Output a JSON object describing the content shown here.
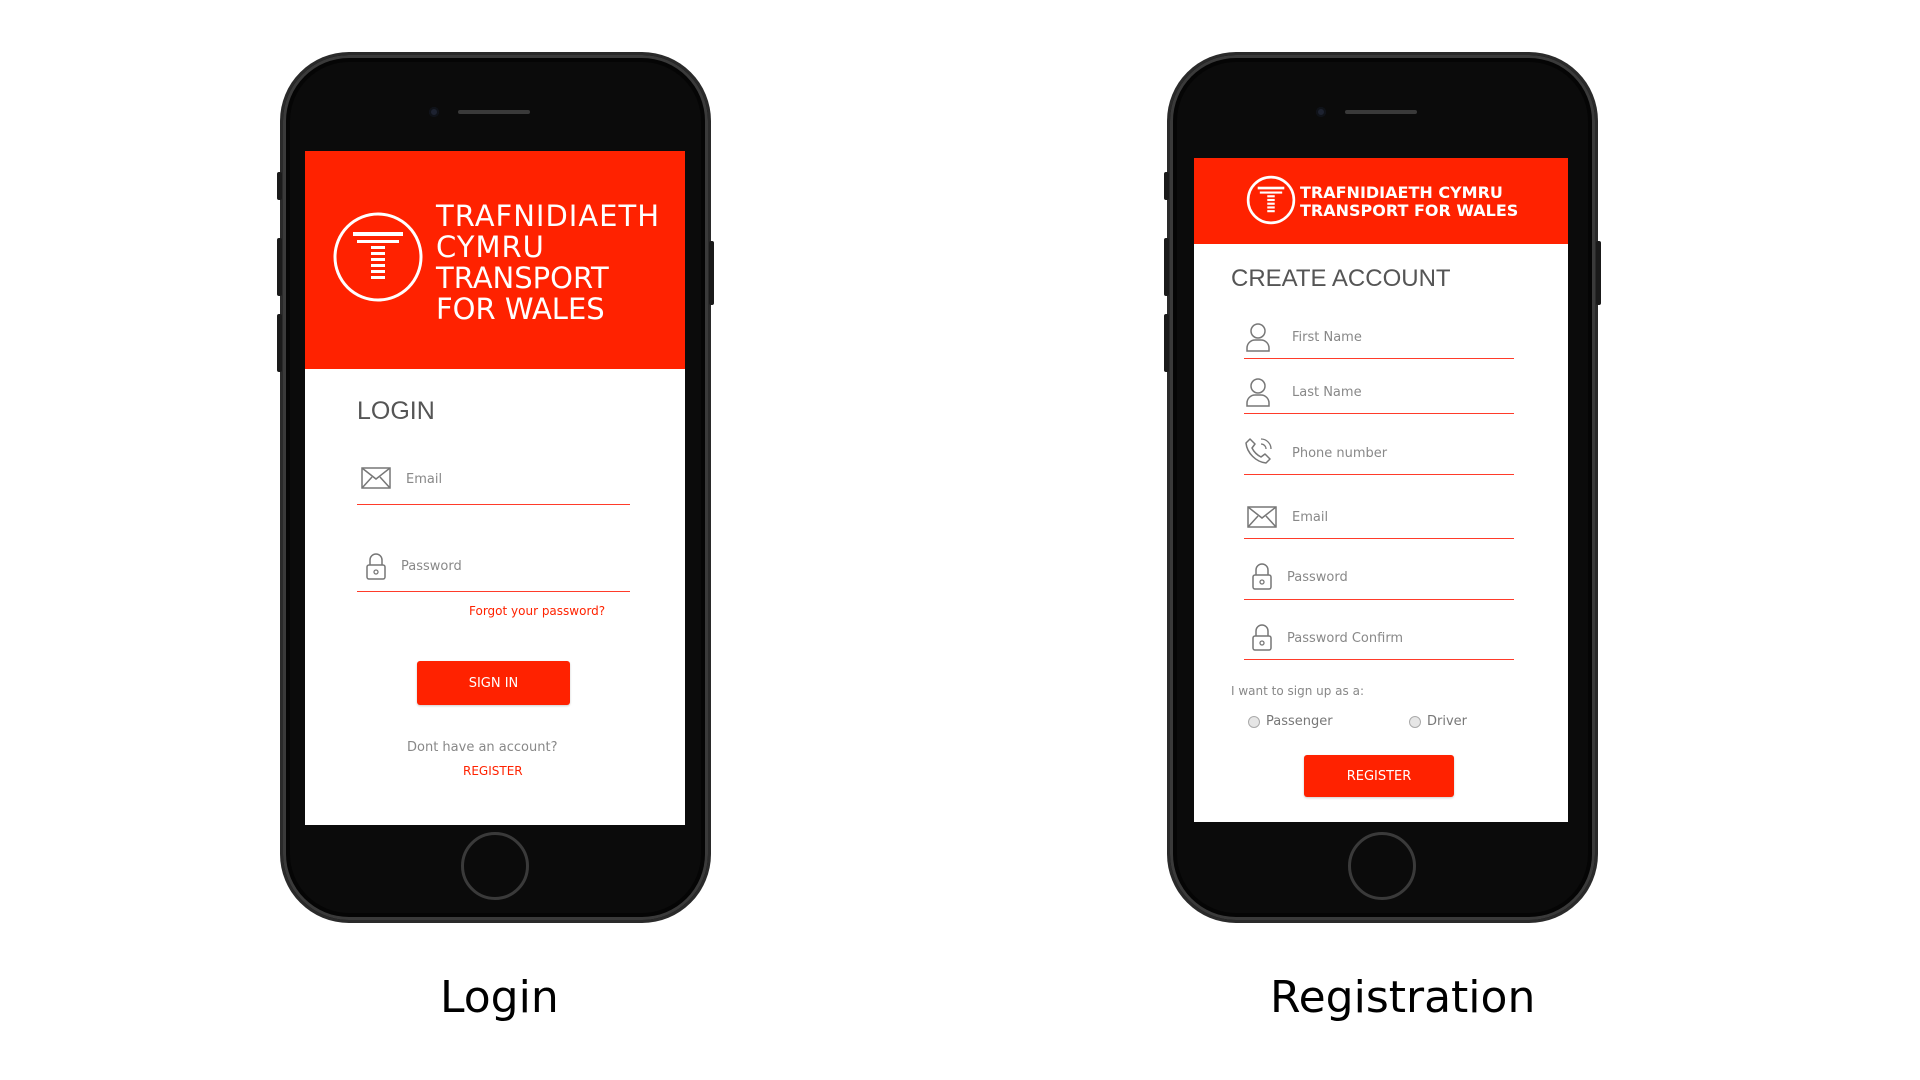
{
  "login_screen": {
    "brand": {
      "line1": "TRAFNIDIAETH",
      "line2": "CYMRU",
      "line3": "TRANSPORT",
      "line4": "FOR WALES"
    },
    "heading": "LOGIN",
    "email_placeholder": "Email",
    "password_placeholder": "Password",
    "forgot_link": "Forgot your password?",
    "sign_in_button": "SIGN IN",
    "no_account_text": "Dont have an account?",
    "register_link": "REGISTER"
  },
  "registration_screen": {
    "brand": {
      "line1": "TRAFNIDIAETH CYMRU",
      "line2": "TRANSPORT FOR WALES"
    },
    "heading": "CREATE ACCOUNT",
    "fields": [
      {
        "icon": "user-icon",
        "placeholder": "First Name"
      },
      {
        "icon": "user-icon",
        "placeholder": "Last Name"
      },
      {
        "icon": "phone-icon",
        "placeholder": "Phone number"
      },
      {
        "icon": "envelope-icon",
        "placeholder": "Email"
      },
      {
        "icon": "lock-icon",
        "placeholder": "Password"
      },
      {
        "icon": "lock-icon",
        "placeholder": "Password Confirm"
      }
    ],
    "signup_prompt": "I want to sign up as a:",
    "roles": [
      "Passenger",
      "Driver"
    ],
    "register_button": "REGISTER"
  },
  "captions": {
    "login": "Login",
    "registration": "Registration"
  },
  "colors": {
    "brand_red": "#ff2200",
    "phone_body": "#0b0b0b"
  }
}
